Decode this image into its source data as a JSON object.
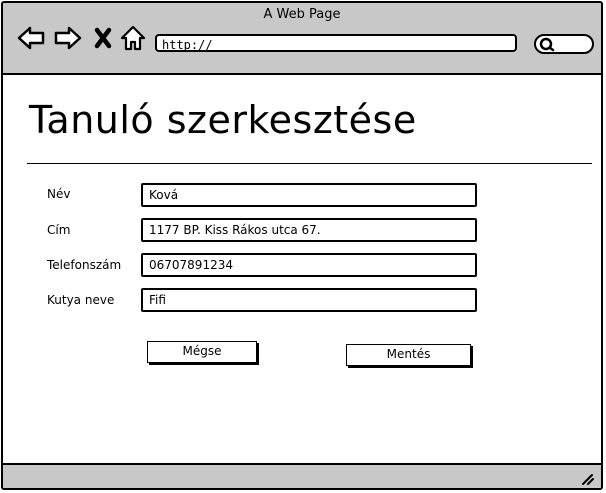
{
  "window": {
    "title": "A Web Page"
  },
  "browser": {
    "url": "http://",
    "icons": [
      "back-icon",
      "forward-icon",
      "close-icon",
      "home-icon",
      "search-icon"
    ]
  },
  "page": {
    "title": "Tanuló szerkesztése"
  },
  "form": {
    "fields": [
      {
        "label": "Név",
        "value": "Ková"
      },
      {
        "label": "Cím",
        "value": "1177 BP. Kiss Rákos utca 67."
      },
      {
        "label": "Telefonszám",
        "value": "06707891234"
      },
      {
        "label": "Kutya neve",
        "value": "Fifi"
      }
    ],
    "cancel_label": "Mégse",
    "save_label": "Mentés"
  }
}
